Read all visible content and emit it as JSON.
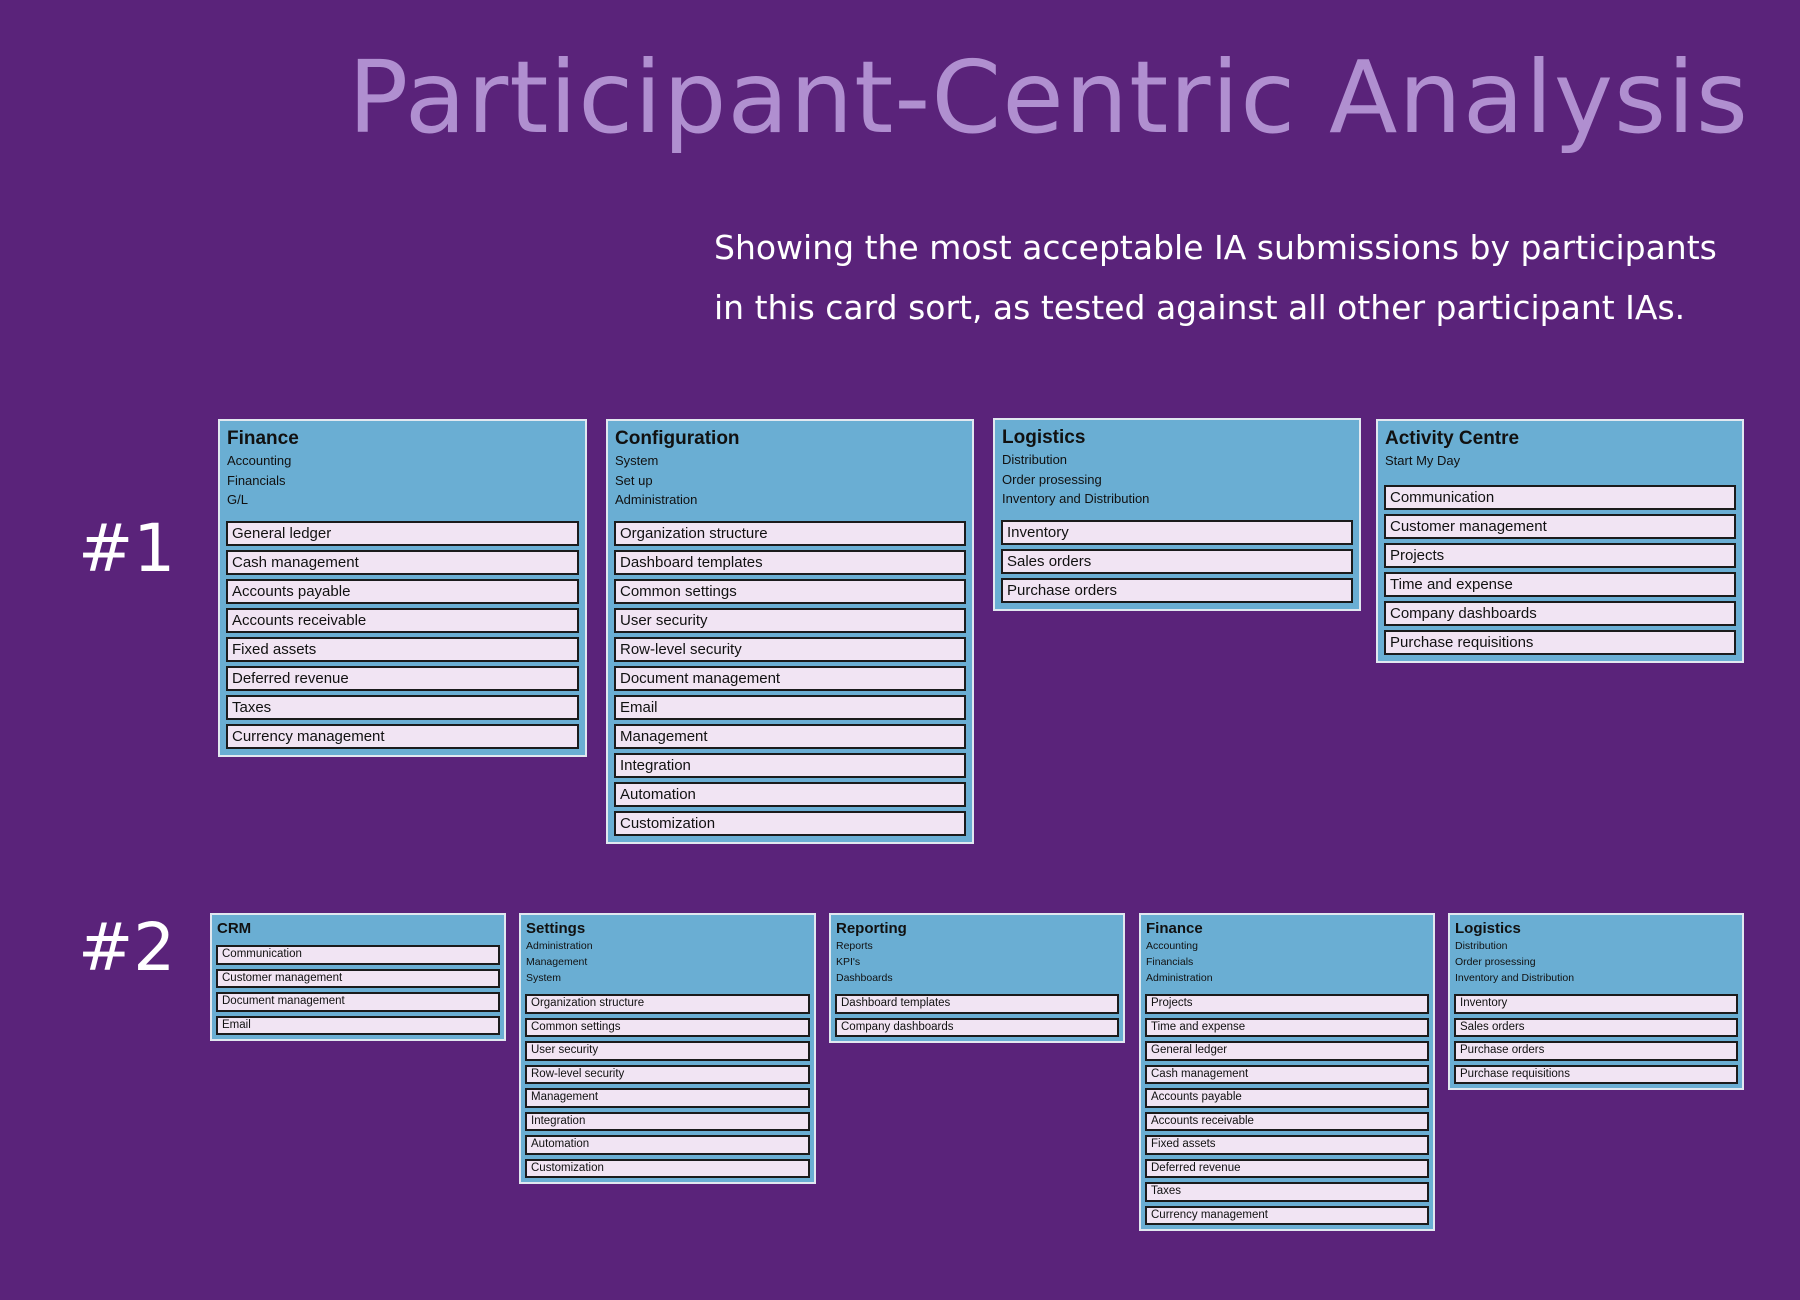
{
  "title": "Participant-Centric Analysis",
  "subtitle": {
    "line1": "Showing the most acceptable IA submissions by participants",
    "line2": "in this card sort, as tested against all other participant IAs."
  },
  "rows": [
    {
      "label": "#1",
      "groups": [
        {
          "title": "Finance",
          "sub": [
            "Accounting",
            "Financials",
            "G/L"
          ],
          "cards": [
            "General ledger",
            "Cash management",
            "Accounts payable",
            "Accounts receivable",
            "Fixed assets",
            "Deferred revenue",
            "Taxes",
            "Currency management"
          ]
        },
        {
          "title": "Configuration",
          "sub": [
            "System",
            "Set up",
            "Administration"
          ],
          "cards": [
            "Organization structure",
            "Dashboard templates",
            "Common settings",
            "User security",
            "Row-level security",
            "Document management",
            "Email",
            "Management",
            "Integration",
            "Automation",
            "Customization"
          ]
        },
        {
          "title": "Logistics",
          "sub": [
            "Distribution",
            "Order prosessing",
            "Inventory and Distribution"
          ],
          "cards": [
            "Inventory",
            "Sales orders",
            "Purchase orders"
          ]
        },
        {
          "title": "Activity Centre",
          "sub": [
            "Start My Day"
          ],
          "cards": [
            "Communication",
            "Customer management",
            "Projects",
            "Time and expense",
            "Company dashboards",
            "Purchase requisitions"
          ]
        }
      ]
    },
    {
      "label": "#2",
      "groups": [
        {
          "title": "CRM",
          "sub": [],
          "cards": [
            "Communication",
            "Customer management",
            "Document management",
            "Email"
          ]
        },
        {
          "title": "Settings",
          "sub": [
            "Administration",
            "Management",
            "System"
          ],
          "cards": [
            "Organization structure",
            "Common settings",
            "User security",
            "Row-level security",
            "Management",
            "Integration",
            "Automation",
            "Customization"
          ]
        },
        {
          "title": "Reporting",
          "sub": [
            "Reports",
            "KPI's",
            "Dashboards"
          ],
          "cards": [
            "Dashboard templates",
            "Company dashboards"
          ]
        },
        {
          "title": "Finance",
          "sub": [
            "Accounting",
            "Financials",
            "Administration"
          ],
          "cards": [
            "Projects",
            "Time and expense",
            "General ledger",
            "Cash management",
            "Accounts payable",
            "Accounts receivable",
            "Fixed assets",
            "Deferred revenue",
            "Taxes",
            "Currency management"
          ]
        },
        {
          "title": "Logistics",
          "sub": [
            "Distribution",
            "Order prosessing",
            "Inventory and Distribution"
          ],
          "cards": [
            "Inventory",
            "Sales orders",
            "Purchase orders",
            "Purchase requisitions"
          ]
        }
      ]
    }
  ]
}
